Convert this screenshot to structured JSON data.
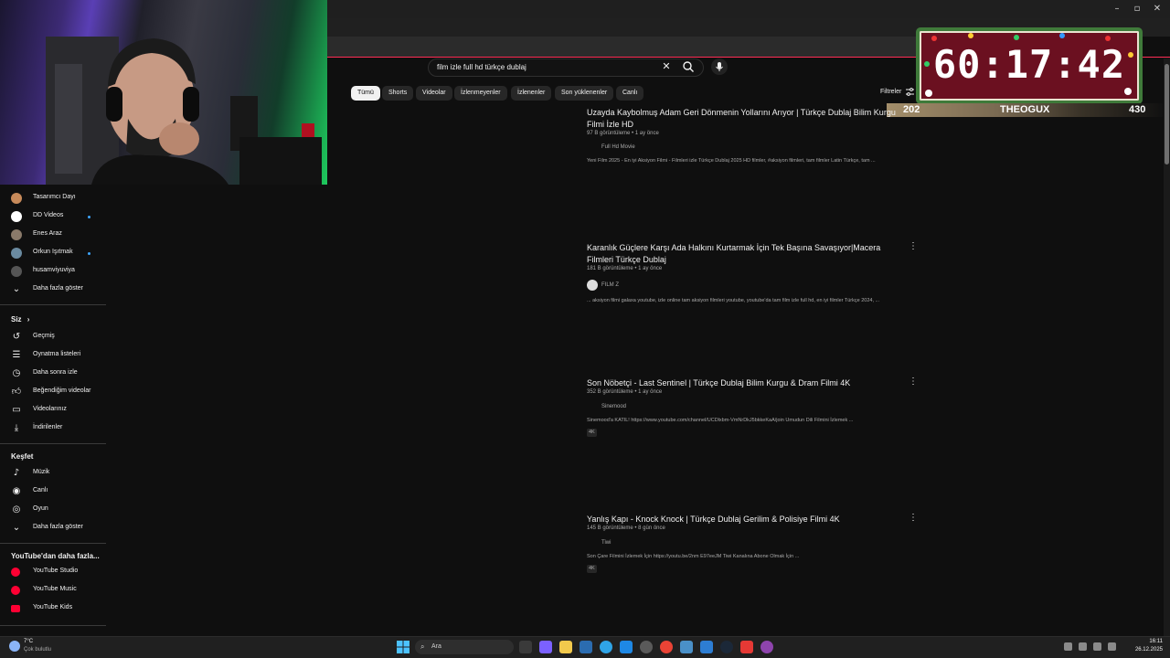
{
  "search": {
    "query": "film izle full hd türkçe dublaj"
  },
  "chips": [
    "Tümü",
    "Shorts",
    "Videolar",
    "İzlenmeyenler",
    "İzlenenler",
    "Son yüklenenler",
    "Canlı"
  ],
  "filters_label": "Filtreler",
  "timer": {
    "time": "60:17:42",
    "left_value": "202",
    "name": "THEOGUX",
    "right_value": "430"
  },
  "sidebar": {
    "subscriptions": [
      {
        "label": "Tasarımcı Dayı",
        "live": false,
        "color": "#c78a5a"
      },
      {
        "label": "DD Videos",
        "live": true,
        "color": "#ffffff"
      },
      {
        "label": "Enes Araz",
        "live": false,
        "color": "#8a7a6a"
      },
      {
        "label": "Orkun Işıtmak",
        "live": true,
        "color": "#6a8aa0"
      },
      {
        "label": "husamviyuviya",
        "live": false,
        "color": "#555555"
      }
    ],
    "show_more": "Daha fazla göster",
    "you_heading": "Siz",
    "you_items": [
      "Geçmiş",
      "Oynatma listeleri",
      "Daha sonra izle",
      "Beğendiğim videolar",
      "Videolarınız",
      "İndirilenler"
    ],
    "explore_heading": "Keşfet",
    "explore_items": [
      "Müzik",
      "Canlı",
      "Oyun"
    ],
    "explore_more": "Daha fazla göster",
    "more_heading": "YouTube'dan daha fazla...",
    "more_items": [
      {
        "label": "YouTube Studio"
      },
      {
        "label": "YouTube Music"
      },
      {
        "label": "YouTube Kids"
      }
    ]
  },
  "results": [
    {
      "title": "Uzayda Kaybolmuş Adam Geri Dönmenin Yollarını Arıyor | Türkçe Dublaj Bilim Kurgu Filmi İzle HD",
      "meta": "97 B görüntüleme • 1 ay önce",
      "channel": "Full Hd Movie",
      "description": "Yeni Film 2025 - En iyi Aksiyon Filmi - Filmleri izle Türkçe Dublaj 2025 HD filmler, #aksiyon filmleri, tam filmler Latin Türkçe, tam ...",
      "badge": ""
    },
    {
      "title": "Karanlık Güçlere Karşı Ada Halkını Kurtarmak İçin Tek Başına Savaşıyor|Macera Filmleri Türkçe Dublaj",
      "meta": "181 B görüntüleme • 1 ay önce",
      "channel": "FILM Z",
      "description": "... aksiyon filmi galaxa youtube, izle online tam aksiyon filmleri youtube, youtube'da tam film izle full hd, en iyi filmler Türkçe 2024, ...",
      "badge": ""
    },
    {
      "title": "Son Nöbetçi - Last Sentinel | Türkçe Dublaj Bilim Kurgu & Dram Filmi 4K",
      "meta": "352 B görüntüleme • 1 ay önce",
      "channel": "Sinemood",
      "description": "Sinemood'a KATIL! https://www.youtube.com/channel/UCDlxbm-VmNrDkJ5bkkeKaA/join Umudun Dili Filmini İzlemek ...",
      "badge": "4K"
    },
    {
      "title": "Yanlış Kapı - Knock Knock | Türkçe Dublaj Gerilim & Polisiye Filmi 4K",
      "meta": "145 B görüntüleme • 8 gün önce",
      "channel": "Tiwi",
      "description": "Son Çare Filmini İzlemek İçin https://youtu.be/2nm E97eeJM Tiwi Kanalına Abone Olmak İçin ...",
      "badge": "4K"
    }
  ],
  "taskbar": {
    "weather_temp": "7°C",
    "weather_desc": "Çok bulutlu",
    "search_placeholder": "Ara",
    "time": "16:11",
    "date": "26.12.2025"
  },
  "colors": {
    "accent_red": "#ff0033",
    "link_blue": "#3ea6ff",
    "background": "#0f0f0f"
  }
}
